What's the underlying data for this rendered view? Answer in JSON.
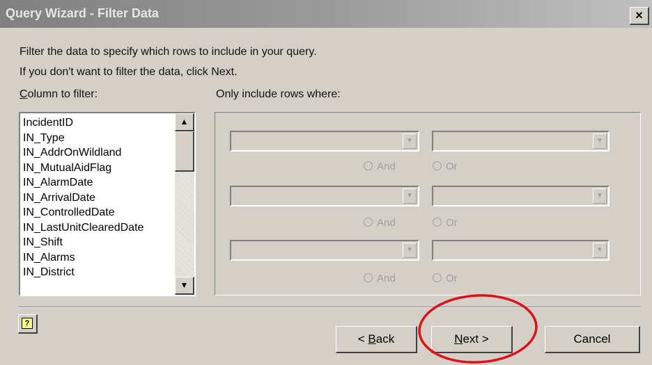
{
  "window": {
    "title": "Query Wizard - Filter Data",
    "close_glyph": "×"
  },
  "instructions": {
    "line1": "Filter the data to specify which rows to include in your query.",
    "line2": "If you don't want to filter the data, click Next."
  },
  "column_panel": {
    "label_accel": "C",
    "label_rest": "olumn to filter:",
    "items": [
      "IncidentID",
      "IN_Type",
      "IN_AddrOnWildland",
      "IN_MutualAidFlag",
      "IN_AlarmDate",
      "IN_ArrivalDate",
      "IN_ControlledDate",
      "IN_LastUnitClearedDate",
      "IN_Shift",
      "IN_Alarms",
      "IN_District"
    ],
    "scroll_up_glyph": "▲",
    "scroll_down_glyph": "▼"
  },
  "criteria_panel": {
    "label": "Only include rows where:",
    "combo_arrow_glyph": "▼",
    "rows": [
      {
        "operator_value": "",
        "value_value": "",
        "and_label": "And",
        "or_label": "Or"
      },
      {
        "operator_value": "",
        "value_value": "",
        "and_label": "And",
        "or_label": "Or"
      },
      {
        "operator_value": "",
        "value_value": "",
        "and_label": "And",
        "or_label": "Or"
      }
    ]
  },
  "buttons": {
    "help_glyph": "?",
    "back_prefix": "< ",
    "back_accel": "B",
    "back_rest": "ack",
    "next_accel": "N",
    "next_rest": "ext >",
    "cancel": "Cancel"
  },
  "colors": {
    "dialog_bg": "#d4d0c8",
    "title_bar": "#808080",
    "annotation": "#e0101a"
  },
  "icons": {
    "close": "close-icon",
    "help": "help-icon",
    "scroll_up": "arrow-up-icon",
    "scroll_down": "arrow-down-icon",
    "combo_dropdown": "chevron-down-icon"
  }
}
